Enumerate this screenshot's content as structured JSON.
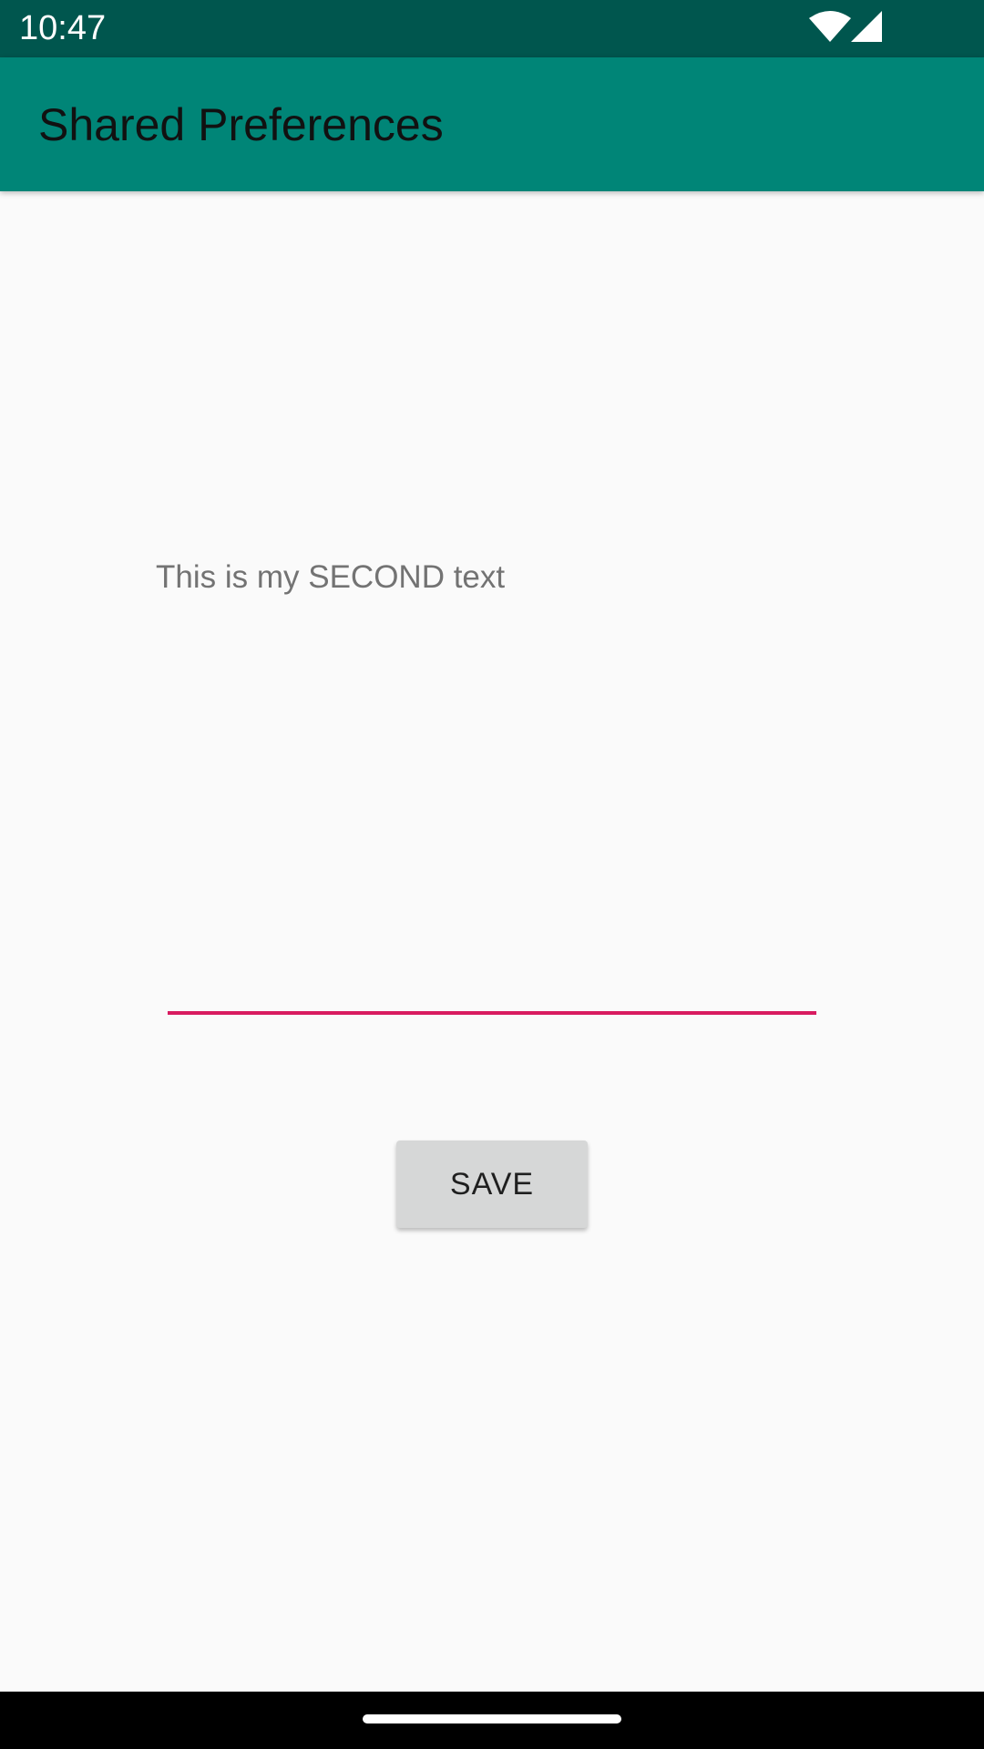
{
  "status_bar": {
    "time": "10:47",
    "icons": [
      "wifi-icon",
      "signal-icon"
    ],
    "color": "#00564e"
  },
  "app_bar": {
    "title": "Shared Preferences",
    "color": "#008577"
  },
  "main": {
    "saved_text": "This is my SECOND text",
    "input": {
      "value": "",
      "placeholder": "",
      "underline_color": "#d81b60"
    },
    "save_button_label": "SAVE"
  },
  "nav_bar": {
    "icons": [
      "home-handle"
    ]
  }
}
